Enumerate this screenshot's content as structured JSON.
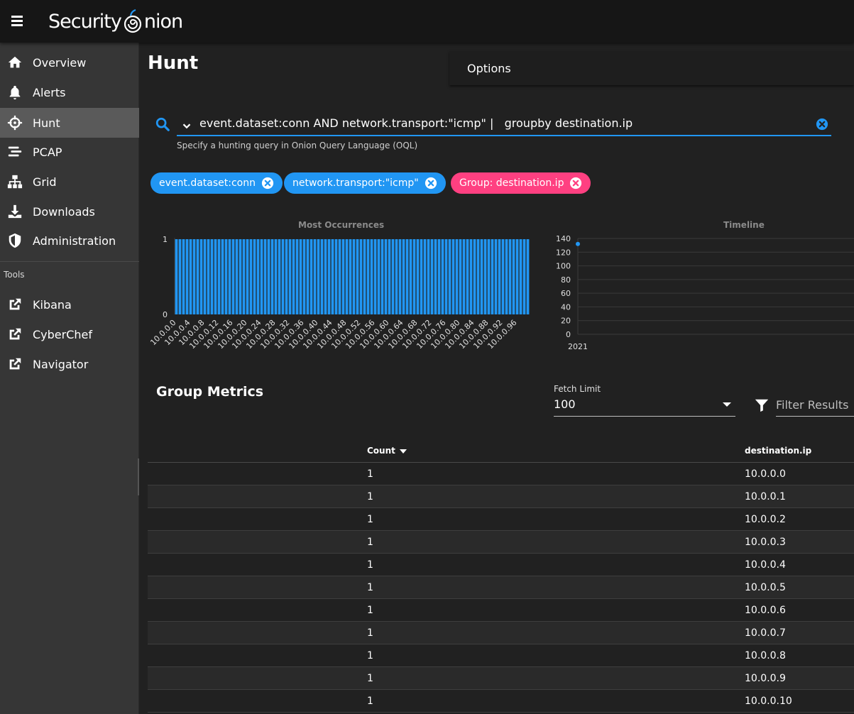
{
  "app": {
    "logo_text_left": "Security",
    "logo_text_right": "nion"
  },
  "sidebar": {
    "items": [
      {
        "label": "Overview",
        "icon": "home-icon"
      },
      {
        "label": "Alerts",
        "icon": "bell-icon"
      },
      {
        "label": "Hunt",
        "icon": "crosshairs-icon",
        "active": true
      },
      {
        "label": "PCAP",
        "icon": "stream-icon"
      },
      {
        "label": "Grid",
        "icon": "sitemap-icon"
      },
      {
        "label": "Downloads",
        "icon": "download-icon"
      },
      {
        "label": "Administration",
        "icon": "shield-icon"
      }
    ],
    "tools_label": "Tools",
    "tools": [
      {
        "label": "Kibana",
        "icon": "external-link-icon"
      },
      {
        "label": "CyberChef",
        "icon": "external-link-icon"
      },
      {
        "label": "Navigator",
        "icon": "external-link-icon"
      }
    ]
  },
  "page": {
    "title": "Hunt",
    "options_label": "Options"
  },
  "query": {
    "value": "event.dataset:conn AND network.transport:\"icmp\" |   groupby destination.ip",
    "hint": "Specify a hunting query in Onion Query Language (OQL)"
  },
  "chips": [
    {
      "label": "event.dataset:conn",
      "color": "#2196f3"
    },
    {
      "label": "network.transport:\"icmp\"",
      "color": "#2196f3"
    },
    {
      "label": "Group: destination.ip",
      "color": "#ff4081"
    }
  ],
  "chart_data": [
    {
      "type": "bar",
      "title": "Most Occurrences",
      "categories_count": 100,
      "category_prefix": "10.0.0.",
      "value_each": 1,
      "tick_labels": [
        "10.0.0.0",
        "10.0.0.4",
        "10.0.0.8",
        "10.0.0.12",
        "10.0.0.16",
        "10.0.0.20",
        "10.0.0.24",
        "10.0.0.28",
        "10.0.0.32",
        "10.0.0.36",
        "10.0.0.40",
        "10.0.0.44",
        "10.0.0.48",
        "10.0.0.52",
        "10.0.0.56",
        "10.0.0.60",
        "10.0.0.64",
        "10.0.0.68",
        "10.0.0.72",
        "10.0.0.76",
        "10.0.0.80",
        "10.0.0.84",
        "10.0.0.88",
        "10.0.0.92",
        "10.0.0.96"
      ],
      "ylim": [
        0,
        1
      ],
      "yticks": [
        "1",
        "0"
      ],
      "color": "#2196f3"
    },
    {
      "type": "line",
      "title": "Timeline",
      "x": [
        "2021"
      ],
      "values": [
        132
      ],
      "ylim": [
        0,
        140
      ],
      "yticks": [
        "140",
        "120",
        "100",
        "80",
        "60",
        "40",
        "20",
        "0"
      ],
      "color": "#2196f3"
    }
  ],
  "metrics": {
    "title": "Group Metrics",
    "fetch_limit_label": "Fetch Limit",
    "fetch_limit_value": "100",
    "filter_placeholder": "Filter Results",
    "columns": [
      "Count",
      "destination.ip"
    ],
    "rows": [
      [
        "1",
        "10.0.0.0"
      ],
      [
        "1",
        "10.0.0.1"
      ],
      [
        "1",
        "10.0.0.2"
      ],
      [
        "1",
        "10.0.0.3"
      ],
      [
        "1",
        "10.0.0.4"
      ],
      [
        "1",
        "10.0.0.5"
      ],
      [
        "1",
        "10.0.0.6"
      ],
      [
        "1",
        "10.0.0.7"
      ],
      [
        "1",
        "10.0.0.8"
      ],
      [
        "1",
        "10.0.0.9"
      ],
      [
        "1",
        "10.0.0.10"
      ]
    ]
  }
}
